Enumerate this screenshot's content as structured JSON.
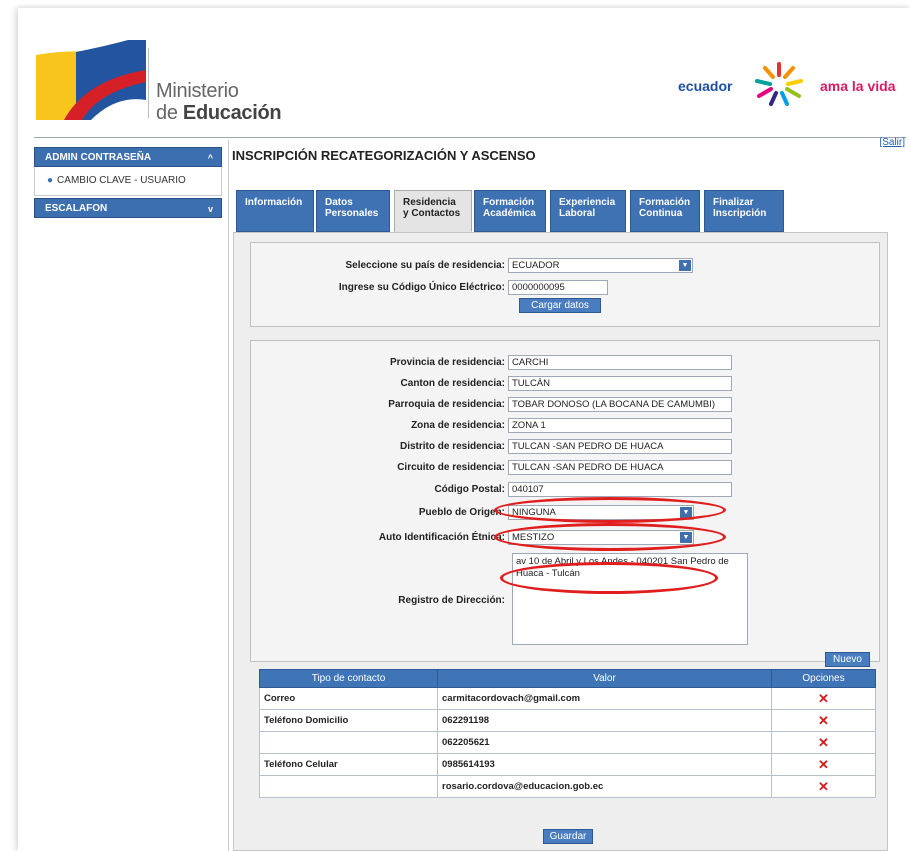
{
  "header": {
    "logo_line1": "Ministerio",
    "logo_line2_prefix": "de ",
    "logo_line2_bold": "Educación",
    "brand_left": "ecuador",
    "brand_right": "ama la vida",
    "logout_link": "[Salir]"
  },
  "sidebar": {
    "section1": {
      "label": "ADMIN CONTRASEÑA",
      "chevron": "^"
    },
    "section1_items": [
      "CAMBIO CLAVE - USUARIO"
    ],
    "section2": {
      "label": "ESCALAFON",
      "chevron": "v"
    }
  },
  "main": {
    "title": "INSCRIPCIÓN RECATEGORIZACIÓN Y ASCENSO",
    "tabs": [
      {
        "line1": "Información",
        "line2": ""
      },
      {
        "line1": "Datos",
        "line2": "Personales"
      },
      {
        "line1": "Residencia",
        "line2": "y Contactos"
      },
      {
        "line1": "Formación",
        "line2": "Académica"
      },
      {
        "line1": "Experiencia",
        "line2": "Laboral"
      },
      {
        "line1": "Formación",
        "line2": "Continua"
      },
      {
        "line1": "Finalizar",
        "line2": "Inscripción"
      }
    ],
    "active_tab_index": 2
  },
  "country_form": {
    "country_label": "Seleccione su país de residencia:",
    "country_value": "ECUADOR",
    "code_label": "Ingrese su Código Único Eléctrico:",
    "code_value": "0000000095",
    "load_button": "Cargar datos"
  },
  "residence_form": {
    "fields": [
      {
        "label": "Provincia de residencia:",
        "value": "CARCHI"
      },
      {
        "label": "Canton de residencia:",
        "value": "TULCÁN"
      },
      {
        "label": "Parroquia de residencia:",
        "value": "TOBAR DONOSO (LA BOCANA DE CAMUMBI)"
      },
      {
        "label": "Zona de residencia:",
        "value": "ZONA 1"
      },
      {
        "label": "Distrito de residencia:",
        "value": "TULCAN -SAN PEDRO DE HUACA"
      },
      {
        "label": "Circuito de residencia:",
        "value": "TULCAN -SAN PEDRO DE HUACA"
      },
      {
        "label": "Código Postal:",
        "value": "040107"
      }
    ],
    "pueblo_label": "Pueblo de Origen:",
    "pueblo_value": "NINGUNA",
    "etnia_label": "Auto Identificación Étnica:",
    "etnia_value": "MESTIZO",
    "address_label": "Registro de Dirección:",
    "address_value": "av 10 de Abril y Los Andes - 040201 San Pedro de Huaca - Tulcán",
    "new_button": "Nuevo"
  },
  "contacts": {
    "columns": [
      "Tipo de contacto",
      "Valor",
      "Opciones"
    ],
    "rows": [
      {
        "type": "Correo",
        "value": "carmitacordovach@gmail.com",
        "option": "✕"
      },
      {
        "type": "Teléfono Domicilio",
        "value": "062291198",
        "option": "✕"
      },
      {
        "type": "",
        "value": "062205621",
        "option": "✕"
      },
      {
        "type": "Teléfono Celular",
        "value": "0985614193",
        "option": "✕"
      },
      {
        "type": "",
        "value": "rosario.cordova@educacion.gob.ec",
        "option": "✕"
      }
    ]
  },
  "footer": {
    "save_button": "Guardar"
  },
  "colors": {
    "accent": "#3e72b3",
    "highlight_oval": "#e01e1e"
  }
}
